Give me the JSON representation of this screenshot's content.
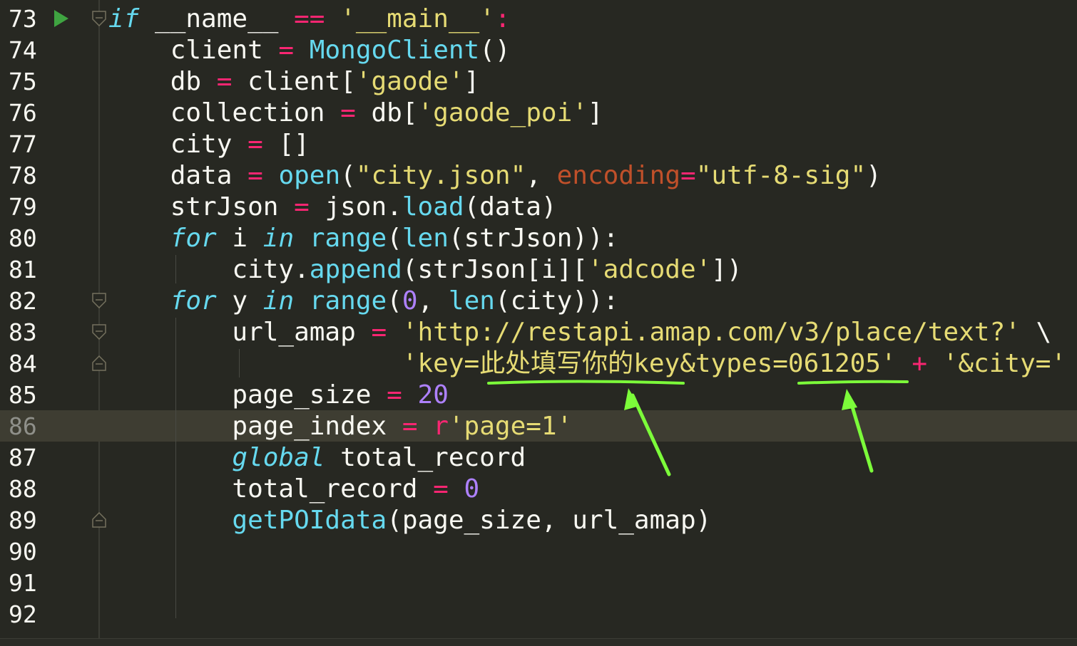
{
  "lines": [
    {
      "num": "73",
      "segments": [
        {
          "t": "if",
          "c": "kwi"
        },
        {
          "t": " __name__ ",
          "c": "var"
        },
        {
          "t": "==",
          "c": "kw"
        },
        {
          "t": " ",
          "c": "var"
        },
        {
          "t": "'__main__'",
          "c": "str"
        },
        {
          "t": ":",
          "c": "kw"
        }
      ]
    },
    {
      "num": "74",
      "segments": [
        {
          "t": "    client ",
          "c": "var"
        },
        {
          "t": "=",
          "c": "kw"
        },
        {
          "t": " ",
          "c": "var"
        },
        {
          "t": "MongoClient",
          "c": "bi"
        },
        {
          "t": "()",
          "c": "var"
        }
      ]
    },
    {
      "num": "75",
      "segments": [
        {
          "t": "    db ",
          "c": "var"
        },
        {
          "t": "=",
          "c": "kw"
        },
        {
          "t": " client[",
          "c": "var"
        },
        {
          "t": "'gaode'",
          "c": "str"
        },
        {
          "t": "]",
          "c": "var"
        }
      ]
    },
    {
      "num": "76",
      "segments": [
        {
          "t": "    collection ",
          "c": "var"
        },
        {
          "t": "=",
          "c": "kw"
        },
        {
          "t": " db[",
          "c": "var"
        },
        {
          "t": "'gaode_poi'",
          "c": "str"
        },
        {
          "t": "]",
          "c": "var"
        }
      ]
    },
    {
      "num": "77",
      "segments": [
        {
          "t": "    city ",
          "c": "var"
        },
        {
          "t": "=",
          "c": "kw"
        },
        {
          "t": " []",
          "c": "var"
        }
      ]
    },
    {
      "num": "78",
      "segments": [
        {
          "t": "    data ",
          "c": "var"
        },
        {
          "t": "=",
          "c": "kw"
        },
        {
          "t": " ",
          "c": "var"
        },
        {
          "t": "open",
          "c": "bi"
        },
        {
          "t": "(",
          "c": "var"
        },
        {
          "t": "\"city.json\"",
          "c": "str"
        },
        {
          "t": ", ",
          "c": "var"
        },
        {
          "t": "encoding",
          "c": "prm2"
        },
        {
          "t": "=",
          "c": "kw"
        },
        {
          "t": "\"utf-8-sig\"",
          "c": "str"
        },
        {
          "t": ")",
          "c": "var"
        }
      ]
    },
    {
      "num": "79",
      "segments": [
        {
          "t": "    strJson ",
          "c": "var"
        },
        {
          "t": "=",
          "c": "kw"
        },
        {
          "t": " json.",
          "c": "var"
        },
        {
          "t": "load",
          "c": "bi"
        },
        {
          "t": "(data)",
          "c": "var"
        }
      ]
    },
    {
      "num": "80",
      "segments": [
        {
          "t": "    ",
          "c": "var"
        },
        {
          "t": "for",
          "c": "kwi"
        },
        {
          "t": " i ",
          "c": "var"
        },
        {
          "t": "in",
          "c": "kwi"
        },
        {
          "t": " ",
          "c": "var"
        },
        {
          "t": "range",
          "c": "bi"
        },
        {
          "t": "(",
          "c": "var"
        },
        {
          "t": "len",
          "c": "bi"
        },
        {
          "t": "(strJson)):",
          "c": "var"
        }
      ]
    },
    {
      "num": "81",
      "segments": [
        {
          "t": "        city.",
          "c": "var"
        },
        {
          "t": "append",
          "c": "bi"
        },
        {
          "t": "(strJson[i][",
          "c": "var"
        },
        {
          "t": "'adcode'",
          "c": "str"
        },
        {
          "t": "])",
          "c": "var"
        }
      ]
    },
    {
      "num": "82",
      "segments": [
        {
          "t": "    ",
          "c": "var"
        },
        {
          "t": "for",
          "c": "kwi"
        },
        {
          "t": " y ",
          "c": "var"
        },
        {
          "t": "in",
          "c": "kwi"
        },
        {
          "t": " ",
          "c": "var"
        },
        {
          "t": "range",
          "c": "bi"
        },
        {
          "t": "(",
          "c": "var"
        },
        {
          "t": "0",
          "c": "num"
        },
        {
          "t": ", ",
          "c": "var"
        },
        {
          "t": "len",
          "c": "bi"
        },
        {
          "t": "(city)):",
          "c": "var"
        }
      ]
    },
    {
      "num": "83",
      "segments": [
        {
          "t": "        url_amap ",
          "c": "var"
        },
        {
          "t": "=",
          "c": "kw"
        },
        {
          "t": " ",
          "c": "var"
        },
        {
          "t": "'http://restapi.amap.com/v3/place/text?'",
          "c": "str"
        },
        {
          "t": " \\",
          "c": "var"
        }
      ]
    },
    {
      "num": "84",
      "segments": [
        {
          "t": "                   ",
          "c": "var"
        },
        {
          "t": "'key=此处填写你的key&types=061205'",
          "c": "str"
        },
        {
          "t": " ",
          "c": "var"
        },
        {
          "t": "+",
          "c": "kw"
        },
        {
          "t": " ",
          "c": "var"
        },
        {
          "t": "'&city='",
          "c": "str"
        }
      ]
    },
    {
      "num": "85",
      "segments": [
        {
          "t": "        page_size ",
          "c": "var"
        },
        {
          "t": "=",
          "c": "kw"
        },
        {
          "t": " ",
          "c": "var"
        },
        {
          "t": "20",
          "c": "num"
        }
      ]
    },
    {
      "num": "86",
      "segments": [
        {
          "t": "        page_index ",
          "c": "var"
        },
        {
          "t": "=",
          "c": "kw"
        },
        {
          "t": " ",
          "c": "var"
        },
        {
          "t": "r",
          "c": "kw"
        },
        {
          "t": "'page=1'",
          "c": "str"
        }
      ]
    },
    {
      "num": "87",
      "segments": [
        {
          "t": "        ",
          "c": "var"
        },
        {
          "t": "global",
          "c": "kwi"
        },
        {
          "t": " total_record",
          "c": "var"
        }
      ]
    },
    {
      "num": "88",
      "segments": [
        {
          "t": "        total_record ",
          "c": "var"
        },
        {
          "t": "=",
          "c": "kw"
        },
        {
          "t": " ",
          "c": "var"
        },
        {
          "t": "0",
          "c": "num"
        }
      ]
    },
    {
      "num": "89",
      "segments": [
        {
          "t": "        ",
          "c": "var"
        },
        {
          "t": "getPOIdata",
          "c": "bi"
        },
        {
          "t": "(page_size, url_amap)",
          "c": "var"
        }
      ]
    },
    {
      "num": "90",
      "segments": []
    },
    {
      "num": "91",
      "segments": []
    },
    {
      "num": "92",
      "segments": []
    }
  ],
  "current_line": "86",
  "run_line": "73",
  "fold_markers": {
    "73": "fold-open",
    "82": "fold-open",
    "83": "fold-open",
    "84": "fold-close",
    "89": "fold-close"
  },
  "annotation_color": "#7cfc3a",
  "colors": {
    "background": "#272822",
    "current_line": "#3e3d32",
    "keyword": "#f92672",
    "builtin": "#66d9ef",
    "string": "#e6db74",
    "number": "#ae81ff",
    "param": "#c0502a"
  }
}
